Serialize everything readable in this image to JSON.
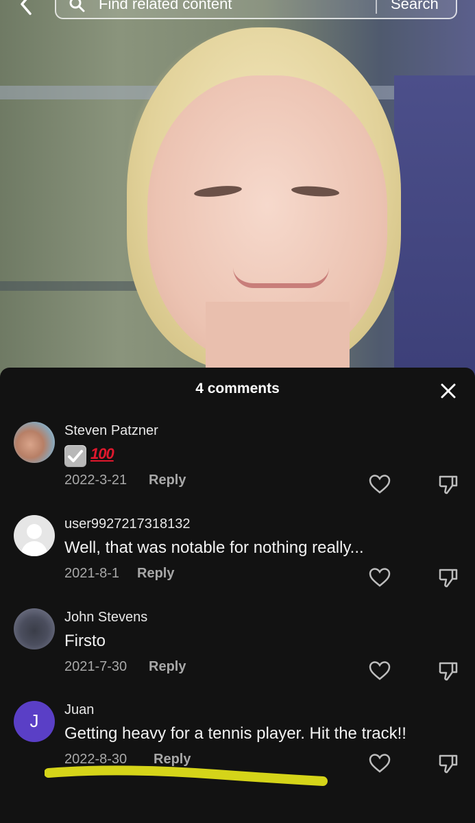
{
  "search": {
    "placeholder": "Find related content",
    "button_label": "Search"
  },
  "comments_panel": {
    "title": "4 comments",
    "comments": [
      {
        "username": "Steven Patzner",
        "text": "✅💯",
        "emoji_names": [
          "check-mark-button-emoji",
          "hundred-points-emoji"
        ],
        "hundred_glyph": "100",
        "date": "2022-3-21",
        "reply_label": "Reply"
      },
      {
        "username": "user9927217318132",
        "text": "Well, that was notable for nothing really...",
        "date": "2021-8-1",
        "reply_label": "Reply"
      },
      {
        "username": "John Stevens",
        "text": "Firsto",
        "date": "2021-7-30",
        "reply_label": "Reply"
      },
      {
        "username": "Juan",
        "avatar_initial": "J",
        "text": "Getting heavy for a tennis player. Hit the track!!",
        "date": "2022-8-30",
        "reply_label": "Reply"
      }
    ]
  },
  "colors": {
    "panel_bg": "#121212",
    "avatar_juan": "#5a3fc6",
    "highlight": "#e6e51a"
  }
}
